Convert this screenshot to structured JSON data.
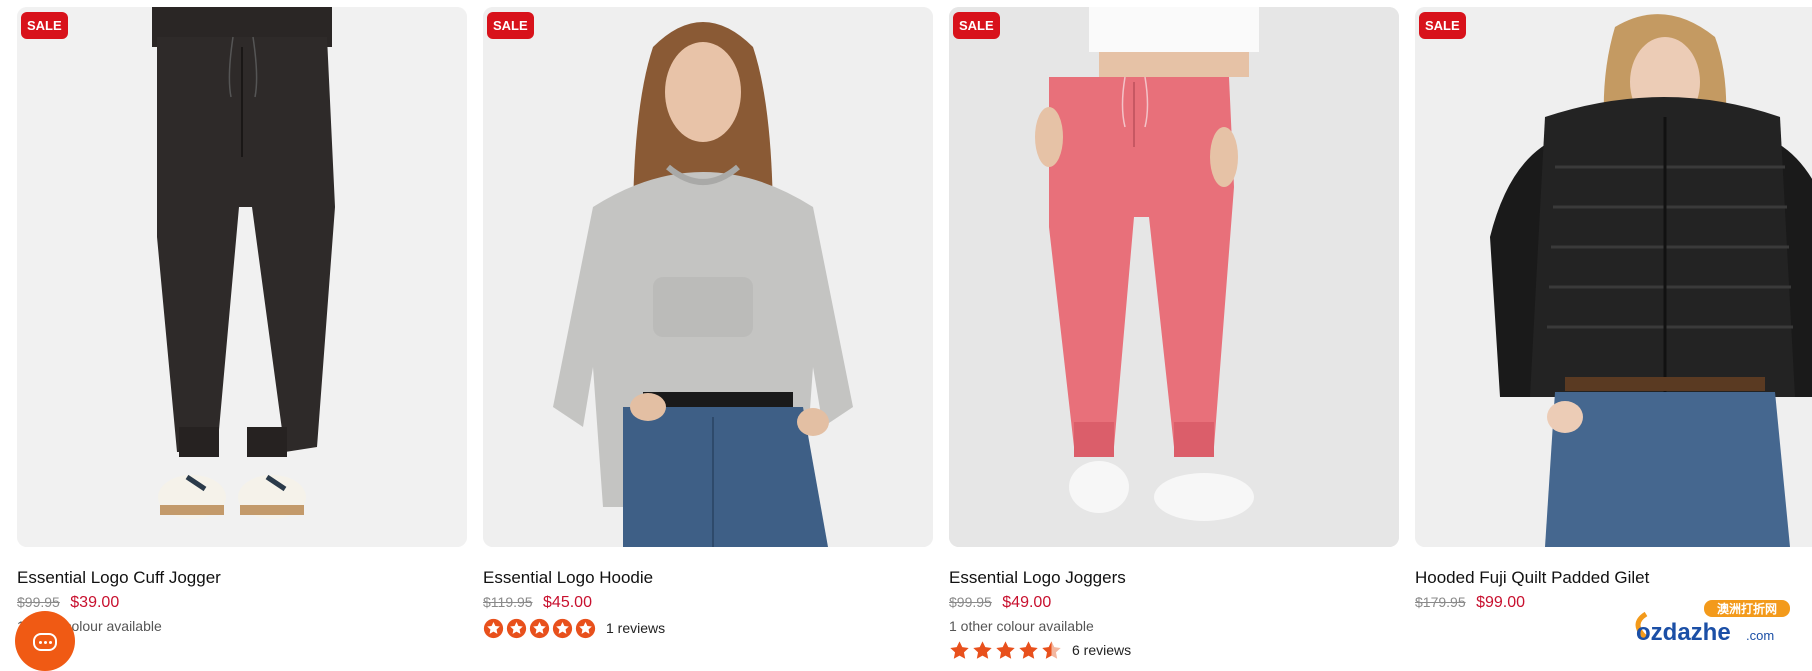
{
  "products": [
    {
      "badge": "SALE",
      "title": "Essential Logo Cuff Jogger",
      "price_was": "$99.95",
      "price_now": "$39.00",
      "colour_note": "1 other colour available",
      "rating": null,
      "reviews": null
    },
    {
      "badge": "SALE",
      "title": "Essential Logo Hoodie",
      "price_was": "$119.95",
      "price_now": "$45.00",
      "colour_note": null,
      "rating": 5,
      "reviews": "1 reviews"
    },
    {
      "badge": "SALE",
      "title": "Essential Logo Joggers",
      "price_was": "$99.95",
      "price_now": "$49.00",
      "colour_note": "1 other colour available",
      "rating": 4.5,
      "reviews": "6 reviews"
    },
    {
      "badge": "SALE",
      "title": "Hooded Fuji Quilt Padded Gilet",
      "price_was": "$179.95",
      "price_now": "$99.00",
      "colour_note": null,
      "rating": null,
      "reviews": null
    }
  ],
  "chat": {
    "icon": "chat-icon"
  },
  "watermark": {
    "top_text": "澳洲打折网",
    "main_text": "ozdazhe",
    "suffix": ".com"
  },
  "colors": {
    "badge_bg": "#d8121b",
    "sale_price": "#c8102e",
    "star": "#e8501c",
    "chat_bg": "#f05a14"
  }
}
